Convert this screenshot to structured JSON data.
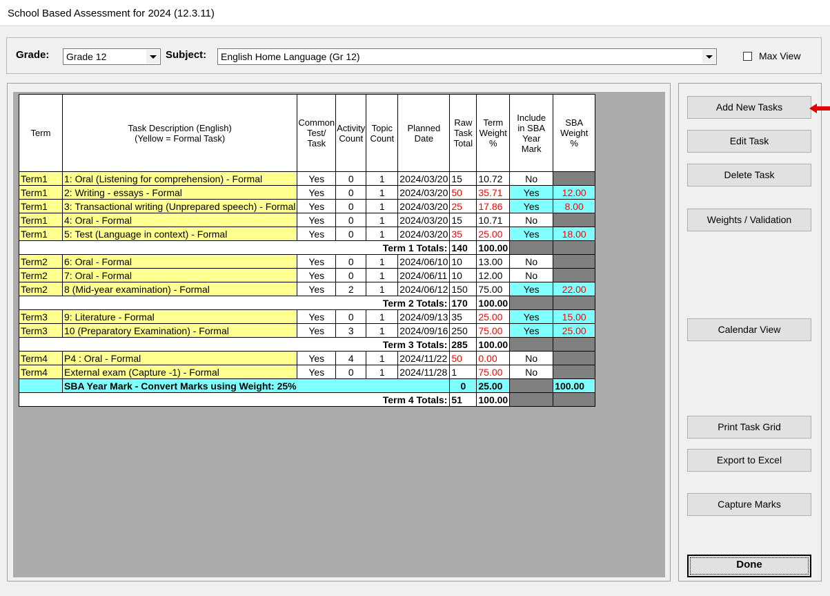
{
  "window": {
    "title": "School Based Assessment for 2024 (12.3.11)"
  },
  "toolbar": {
    "grade_label": "Grade:",
    "grade_value": "Grade 12",
    "subject_label": "Subject:",
    "subject_value": "English Home Language (Gr 12)",
    "max_view_label": "Max View",
    "max_view_checked": false
  },
  "table": {
    "headers": {
      "term": "Term",
      "task_desc": "Task Description (English)\n(Yellow = Formal Task)",
      "common": "Common\nTest/\nTask",
      "activity": "Activity\nCount",
      "topic": "Topic\nCount",
      "planned": "Planned\nDate",
      "raw": "Raw\nTask\nTotal",
      "term_weight": "Term\nWeight\n%",
      "include": "Include\nin SBA\nYear\nMark",
      "sba_weight": "SBA\nWeight\n%"
    },
    "rows": [
      {
        "kind": "task",
        "term": "Term1",
        "desc": "1: Oral (Listening for comprehension) - Formal",
        "common": "Yes",
        "activity": "0",
        "topic": "1",
        "date": "2024/03/20",
        "raw": "15",
        "raw_red": false,
        "tw": "10.72",
        "tw_red": false,
        "include": "No",
        "sba": ""
      },
      {
        "kind": "task",
        "term": "Term1",
        "desc": "2: Writing - essays - Formal",
        "common": "Yes",
        "activity": "0",
        "topic": "1",
        "date": "2024/03/20",
        "raw": "50",
        "raw_red": true,
        "tw": "35.71",
        "tw_red": true,
        "include": "Yes",
        "sba": "12.00"
      },
      {
        "kind": "task",
        "term": "Term1",
        "desc": "3: Transactional writing (Unprepared speech) - Formal",
        "common": "Yes",
        "activity": "0",
        "topic": "1",
        "date": "2024/03/20",
        "raw": "25",
        "raw_red": true,
        "tw": "17.86",
        "tw_red": true,
        "include": "Yes",
        "sba": "8.00"
      },
      {
        "kind": "task",
        "term": "Term1",
        "desc": "4: Oral - Formal",
        "common": "Yes",
        "activity": "0",
        "topic": "1",
        "date": "2024/03/20",
        "raw": "15",
        "raw_red": false,
        "tw": "10.71",
        "tw_red": false,
        "include": "No",
        "sba": ""
      },
      {
        "kind": "task",
        "term": "Term1",
        "desc": "5: Test (Language in context) - Formal",
        "common": "Yes",
        "activity": "0",
        "topic": "1",
        "date": "2024/03/20",
        "raw": "35",
        "raw_red": true,
        "tw": "25.00",
        "tw_red": true,
        "include": "Yes",
        "sba": "18.00"
      },
      {
        "kind": "total",
        "label": "Term 1 Totals:",
        "raw": "140",
        "tw": "100.00"
      },
      {
        "kind": "task",
        "term": "Term2",
        "desc": "6: Oral - Formal",
        "common": "Yes",
        "activity": "0",
        "topic": "1",
        "date": "2024/06/10",
        "raw": "10",
        "raw_red": false,
        "tw": "13.00",
        "tw_red": false,
        "include": "No",
        "sba": ""
      },
      {
        "kind": "task",
        "term": "Term2",
        "desc": "7: Oral - Formal",
        "common": "Yes",
        "activity": "0",
        "topic": "1",
        "date": "2024/06/11",
        "raw": "10",
        "raw_red": false,
        "tw": "12.00",
        "tw_red": false,
        "include": "No",
        "sba": ""
      },
      {
        "kind": "task",
        "term": "Term2",
        "desc": "8 (Mid-year examination) - Formal",
        "common": "Yes",
        "activity": "2",
        "topic": "1",
        "date": "2024/06/12",
        "raw": "150",
        "raw_red": false,
        "tw": "75.00",
        "tw_red": false,
        "include": "Yes",
        "sba": "22.00"
      },
      {
        "kind": "total",
        "label": "Term 2 Totals:",
        "raw": "170",
        "tw": "100.00"
      },
      {
        "kind": "task",
        "term": "Term3",
        "desc": "9: Literature - Formal",
        "common": "Yes",
        "activity": "0",
        "topic": "1",
        "date": "2024/09/13",
        "raw": "35",
        "raw_red": false,
        "tw": "25.00",
        "tw_red": true,
        "include": "Yes",
        "sba": "15.00"
      },
      {
        "kind": "task",
        "term": "Term3",
        "desc": "10 (Preparatory Examination) - Formal",
        "common": "Yes",
        "activity": "3",
        "topic": "1",
        "date": "2024/09/16",
        "raw": "250",
        "raw_red": false,
        "tw": "75.00",
        "tw_red": true,
        "include": "Yes",
        "sba": "25.00"
      },
      {
        "kind": "total",
        "label": "Term 3 Totals:",
        "raw": "285",
        "tw": "100.00"
      },
      {
        "kind": "task",
        "term": "Term4",
        "desc": "P4 : Oral - Formal",
        "common": "Yes",
        "activity": "4",
        "topic": "1",
        "date": "2024/11/22",
        "raw": "50",
        "raw_red": true,
        "tw": "0.00",
        "tw_red": true,
        "include": "No",
        "sba": ""
      },
      {
        "kind": "task",
        "term": "Term4",
        "desc": "External exam (Capture -1) - Formal",
        "common": "Yes",
        "activity": "0",
        "topic": "1",
        "date": "2024/11/28",
        "raw": "1",
        "raw_red": false,
        "tw": "75.00",
        "tw_red": true,
        "include": "No",
        "sba": ""
      },
      {
        "kind": "sba",
        "label": "SBA Year Mark - Convert Marks using Weight: 25%",
        "raw": "0",
        "tw": "25.00",
        "sba": "100.00"
      },
      {
        "kind": "total",
        "label": "Term 4 Totals:",
        "raw": "51",
        "tw": "100.00"
      }
    ]
  },
  "buttons": {
    "add_new_tasks": "Add New Tasks",
    "edit_task": "Edit Task",
    "delete_task": "Delete Task",
    "weights_validation": "Weights / Validation",
    "calendar_view": "Calendar View",
    "print_task_grid": "Print Task Grid",
    "export_to_excel": "Export to Excel",
    "capture_marks": "Capture Marks",
    "done": "Done"
  },
  "icons": {
    "pointer": "red-arrow-icon"
  },
  "colors": {
    "formal_task": "#ffff8f",
    "included_cell": "#80ffff",
    "disabled_cell": "#808080",
    "warning_text": "#ff0000",
    "grid_background": "#ababab",
    "arrow": "#e00000"
  }
}
